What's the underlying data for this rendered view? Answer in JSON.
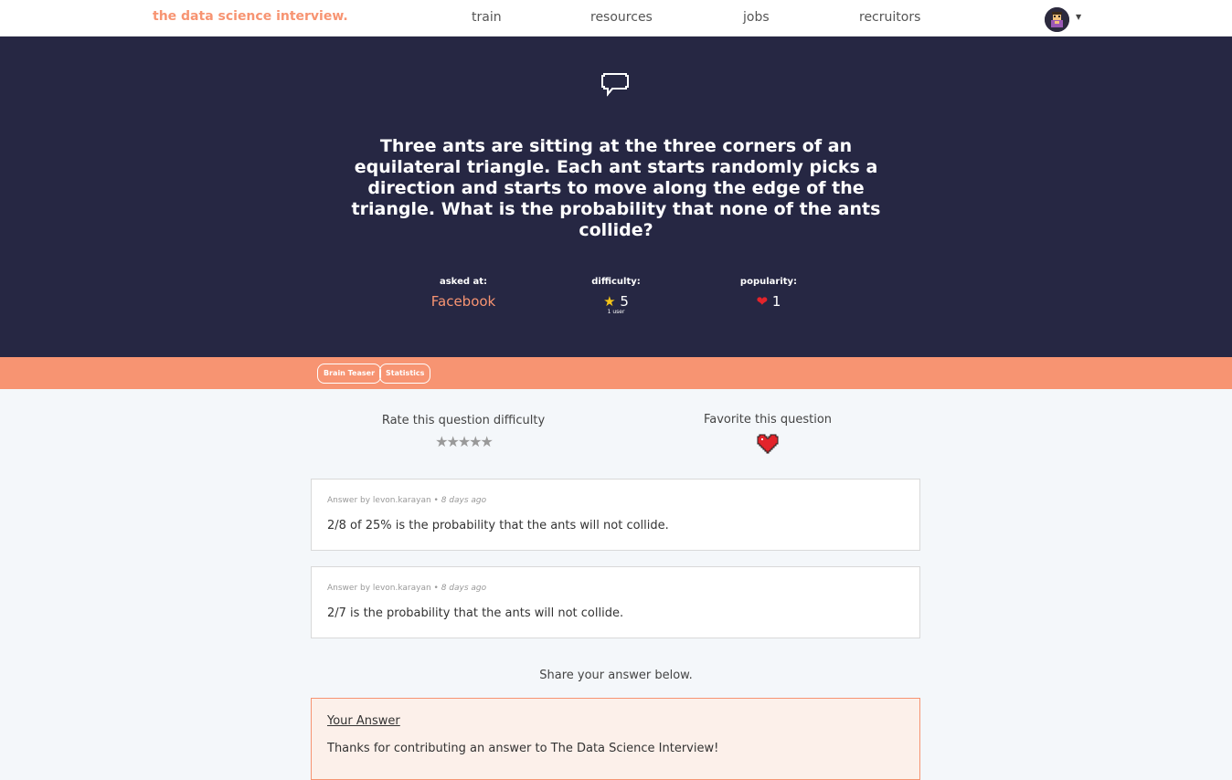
{
  "nav": {
    "brand": "the data science interview.",
    "links": [
      "train",
      "resources",
      "jobs",
      "recruitors"
    ]
  },
  "hero": {
    "icon": "speech-bubble-icon",
    "question": "Three ants are sitting at the three corners of an equilateral triangle. Each ant starts randomly picks a direction and starts to move along the edge of the triangle. What is the probability that none of the ants collide?",
    "asked_label": "asked at:",
    "company": "Facebook",
    "difficulty_label": "difficulty:",
    "difficulty_value": "5",
    "difficulty_sub": "1 user",
    "popularity_label": "popularity:",
    "popularity_value": "1"
  },
  "tags": [
    "Brain Teaser",
    "Statistics"
  ],
  "rate": {
    "label": "Rate this question difficulty",
    "stars": "★★★★★"
  },
  "favorite": {
    "label": "Favorite this question"
  },
  "answers": [
    {
      "author": "Answer by levon.karayan •",
      "time": "8 days ago",
      "text": "2/8 of 25% is the probability that the ants will not collide."
    },
    {
      "author": "Answer by levon.karayan •",
      "time": "8 days ago",
      "text": "2/7 is the probability that the ants will not collide."
    }
  ],
  "share": "Share your answer below.",
  "your_answer": {
    "title": "Your Answer",
    "text": "Thanks for contributing an answer to The Data Science Interview!"
  },
  "colors": {
    "accent": "#f79472",
    "hero_bg": "#262743",
    "heart": "#e3242b",
    "star": "#f5c518"
  }
}
